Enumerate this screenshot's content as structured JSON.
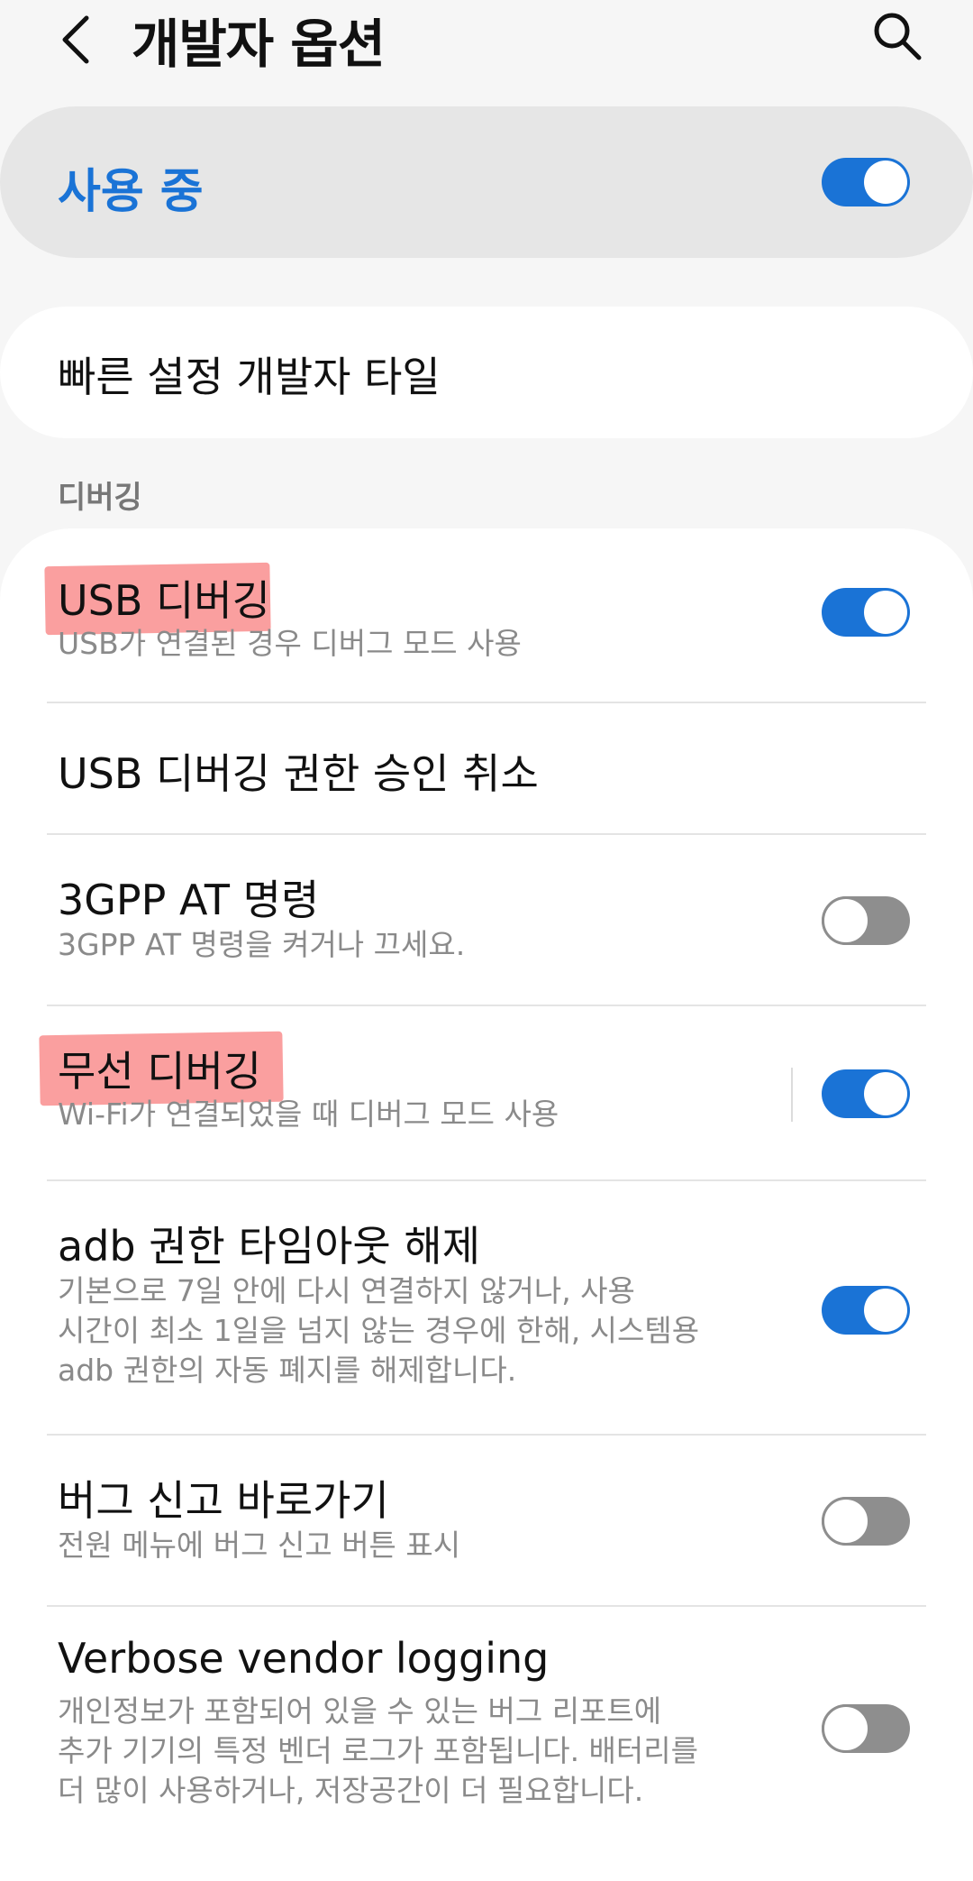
{
  "header": {
    "title": "개발자 옵션",
    "back_icon": "chevron-left-icon",
    "search_icon": "search-icon"
  },
  "master": {
    "label": "사용 중",
    "enabled": true,
    "accent": "#1a73d6"
  },
  "quick_tile": {
    "label": "빠른 설정 개발자 타일"
  },
  "section": {
    "title": "디버깅"
  },
  "items": [
    {
      "title": "USB 디버깅",
      "subtitle": "USB가 연결된 경우 디버그 모드 사용",
      "toggle": true,
      "highlighted": true
    },
    {
      "title": "USB 디버깅 권한 승인 취소"
    },
    {
      "title": "3GPP AT 명령",
      "subtitle": "3GPP AT 명령을 켜거나 끄세요.",
      "toggle": false
    },
    {
      "title": "무선 디버깅",
      "subtitle": "Wi-Fi가 연결되었을 때 디버그 모드 사용",
      "toggle": true,
      "highlighted": true
    },
    {
      "title": "adb 권한 타임아웃 해제",
      "subtitle_lines": [
        "기본으로 7일 안에 다시 연결하지 않거나, 사용",
        "시간이 최소 1일을 넘지 않는 경우에 한해, 시스템용",
        "adb 권한의 자동 폐지를 해제합니다."
      ],
      "toggle": true
    },
    {
      "title": "버그 신고 바로가기",
      "subtitle": "전원 메뉴에 버그 신고 버튼 표시",
      "toggle": false
    },
    {
      "title": "Verbose vendor logging",
      "subtitle_lines": [
        "개인정보가 포함되어 있을 수 있는 버그 리포트에",
        "추가 기기의 특정 벤더 로그가 포함됩니다. 배터리를",
        "더 많이 사용하거나, 저장공간이 더 필요합니다."
      ],
      "toggle": false
    }
  ]
}
